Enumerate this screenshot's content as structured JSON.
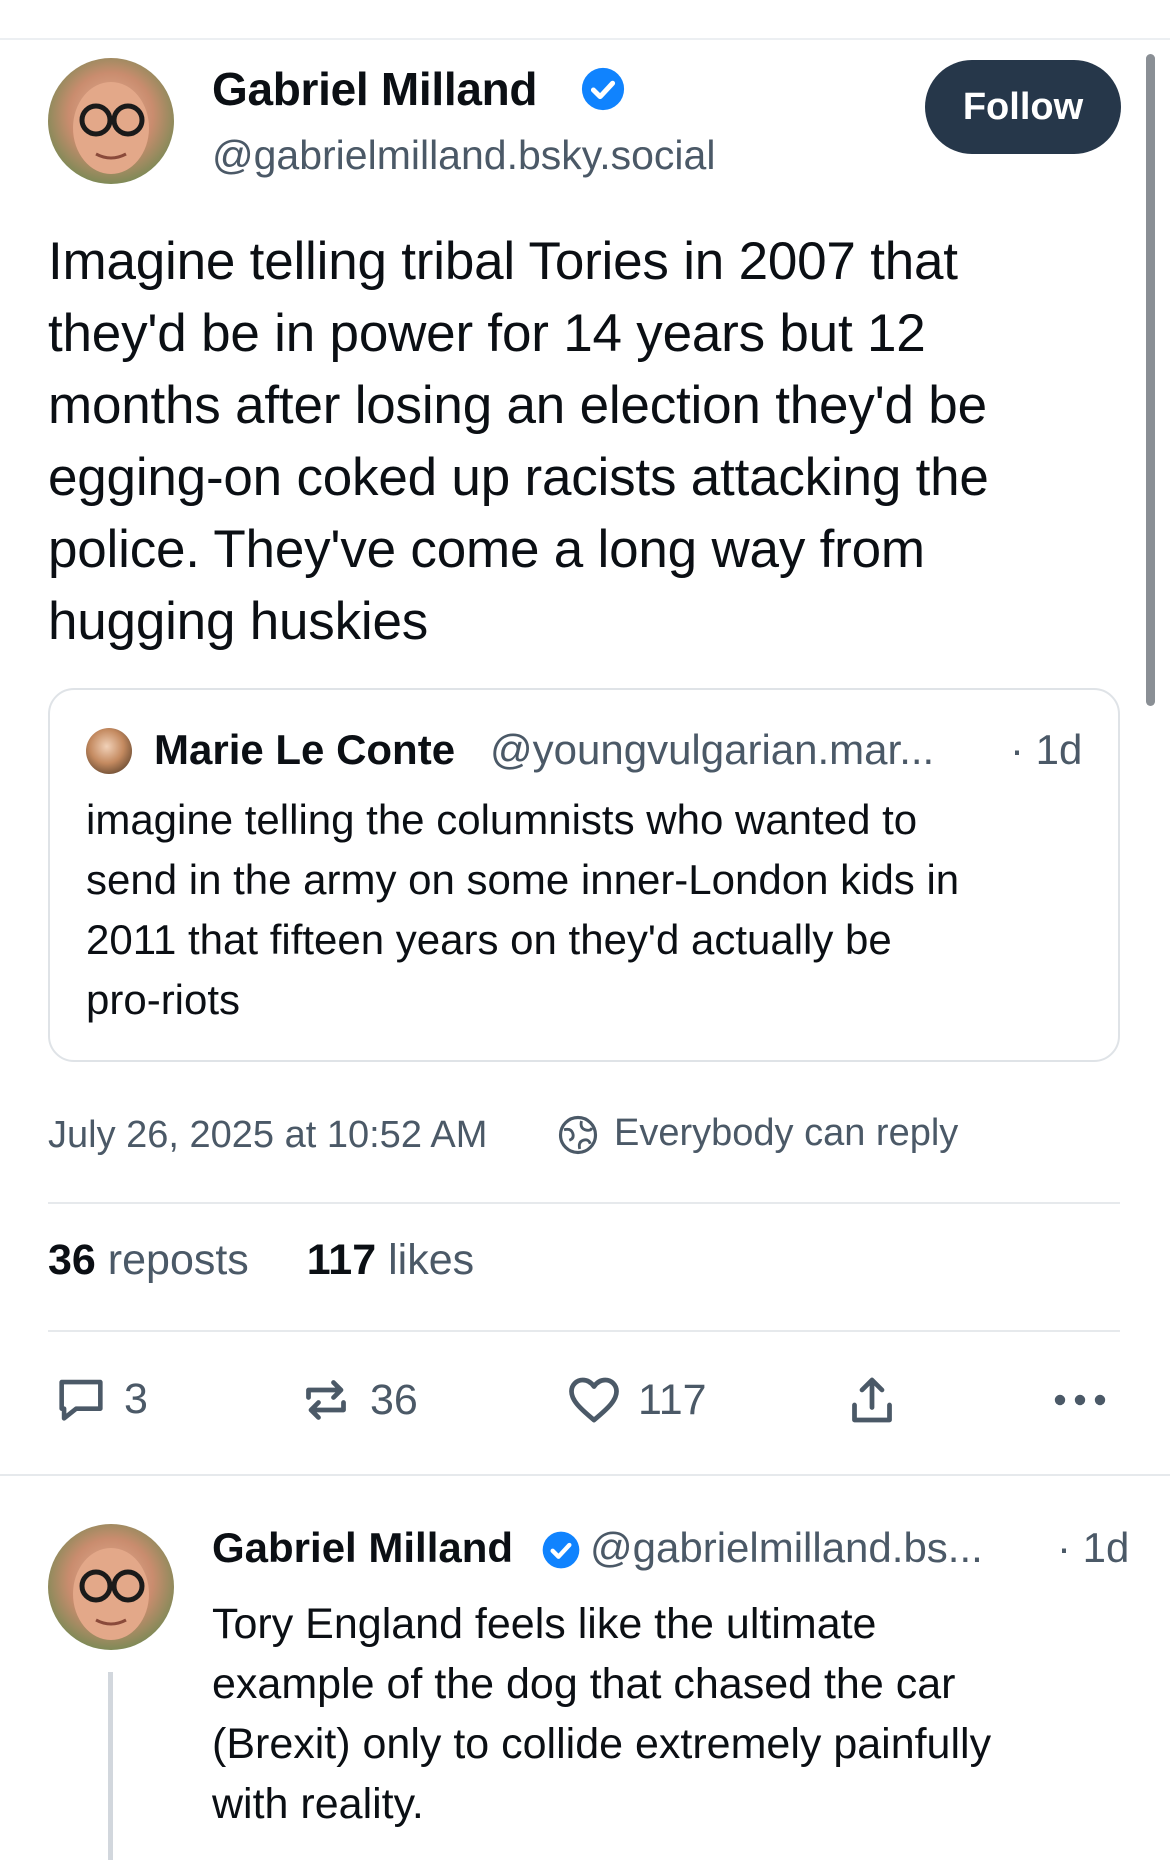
{
  "post": {
    "author": {
      "name": "Gabriel Milland",
      "handle": "@gabrielmilland.bsky.social",
      "verified": true
    },
    "follow_label": "Follow",
    "text": "Imagine telling tribal Tories in 2007 that\nthey'd be in power for 14 years but 12\nmonths after losing an election they'd be\negging-on coked up racists attacking the\npolice. They've come a long way from\nhugging huskies",
    "quoted": {
      "author_name": "Marie Le Conte",
      "handle": "@youngvulgarian.mar...",
      "time": "· 1d",
      "text": "imagine telling the columnists who wanted to\nsend in the army on some inner-London kids in\n2011 that fifteen years on they'd actually be\npro-riots"
    },
    "date": "July 26, 2025 at 10:52 AM",
    "reply_setting": "Everybody can reply",
    "stats": {
      "reposts_count": "36",
      "reposts_label": "reposts",
      "likes_count": "117",
      "likes_label": "likes"
    },
    "actions": {
      "replies": "3",
      "reposts": "36",
      "likes": "117"
    }
  },
  "reply": {
    "author_name": "Gabriel Milland",
    "handle": "@gabrielmilland.bs...",
    "time": "· 1d",
    "verified": true,
    "text": "Tory England feels like the ultimate\nexample of the dog that chased the car\n(Brexit) only to collide extremely painfully\nwith reality."
  },
  "colors": {
    "accent_verified": "#1083fe",
    "follow_button_bg": "#26374a",
    "secondary_text": "#4b5967"
  }
}
